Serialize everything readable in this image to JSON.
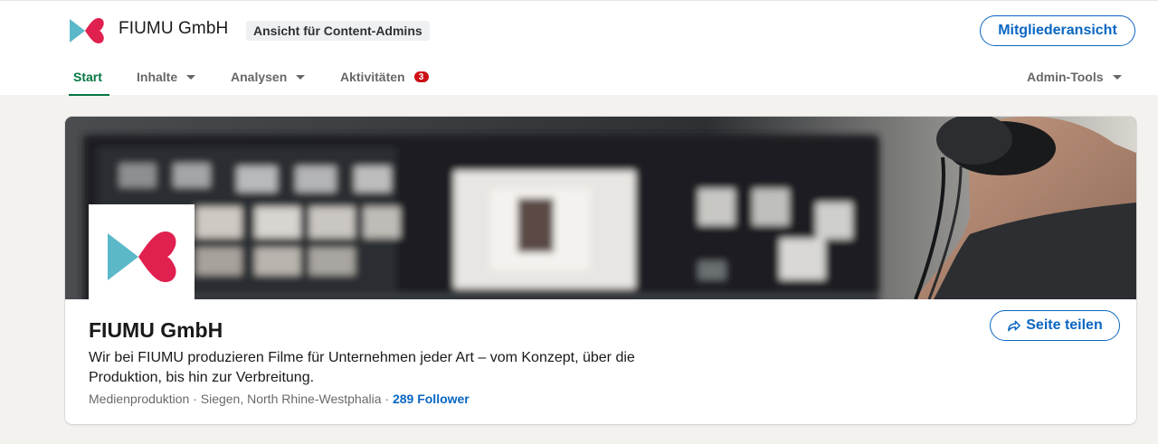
{
  "header": {
    "company_name": "FIUMU GmbH",
    "admin_view_badge": "Ansicht für Content-Admins",
    "member_view_button": "Mitgliederansicht"
  },
  "nav": {
    "tabs": [
      {
        "label": "Start",
        "active": true
      },
      {
        "label": "Inhalte",
        "dropdown": true
      },
      {
        "label": "Analysen",
        "dropdown": true
      },
      {
        "label": "Aktivitäten",
        "badge": "3"
      }
    ],
    "admin_tools": "Admin-Tools"
  },
  "profile": {
    "name": "FIUMU GmbH",
    "tagline": "Wir bei FIUMU produzieren Filme für Unternehmen jeder Art – vom Konzept, über die Produktion, bis hin zur Verbreitung.",
    "industry": "Medienproduktion",
    "location": "Siegen, North Rhine-Westphalia",
    "separator": "·",
    "followers": "289 Follower",
    "share_button": "Seite teilen"
  },
  "icons": {
    "logo": "fiumu-logo-icon",
    "share": "share-arrow-icon",
    "caret": "chevron-down-icon"
  },
  "colors": {
    "accent": "#0a66c2",
    "active_tab": "#057642",
    "logo_teal": "#5bb8c9",
    "logo_red": "#e0204f",
    "notification": "#cc1016"
  }
}
